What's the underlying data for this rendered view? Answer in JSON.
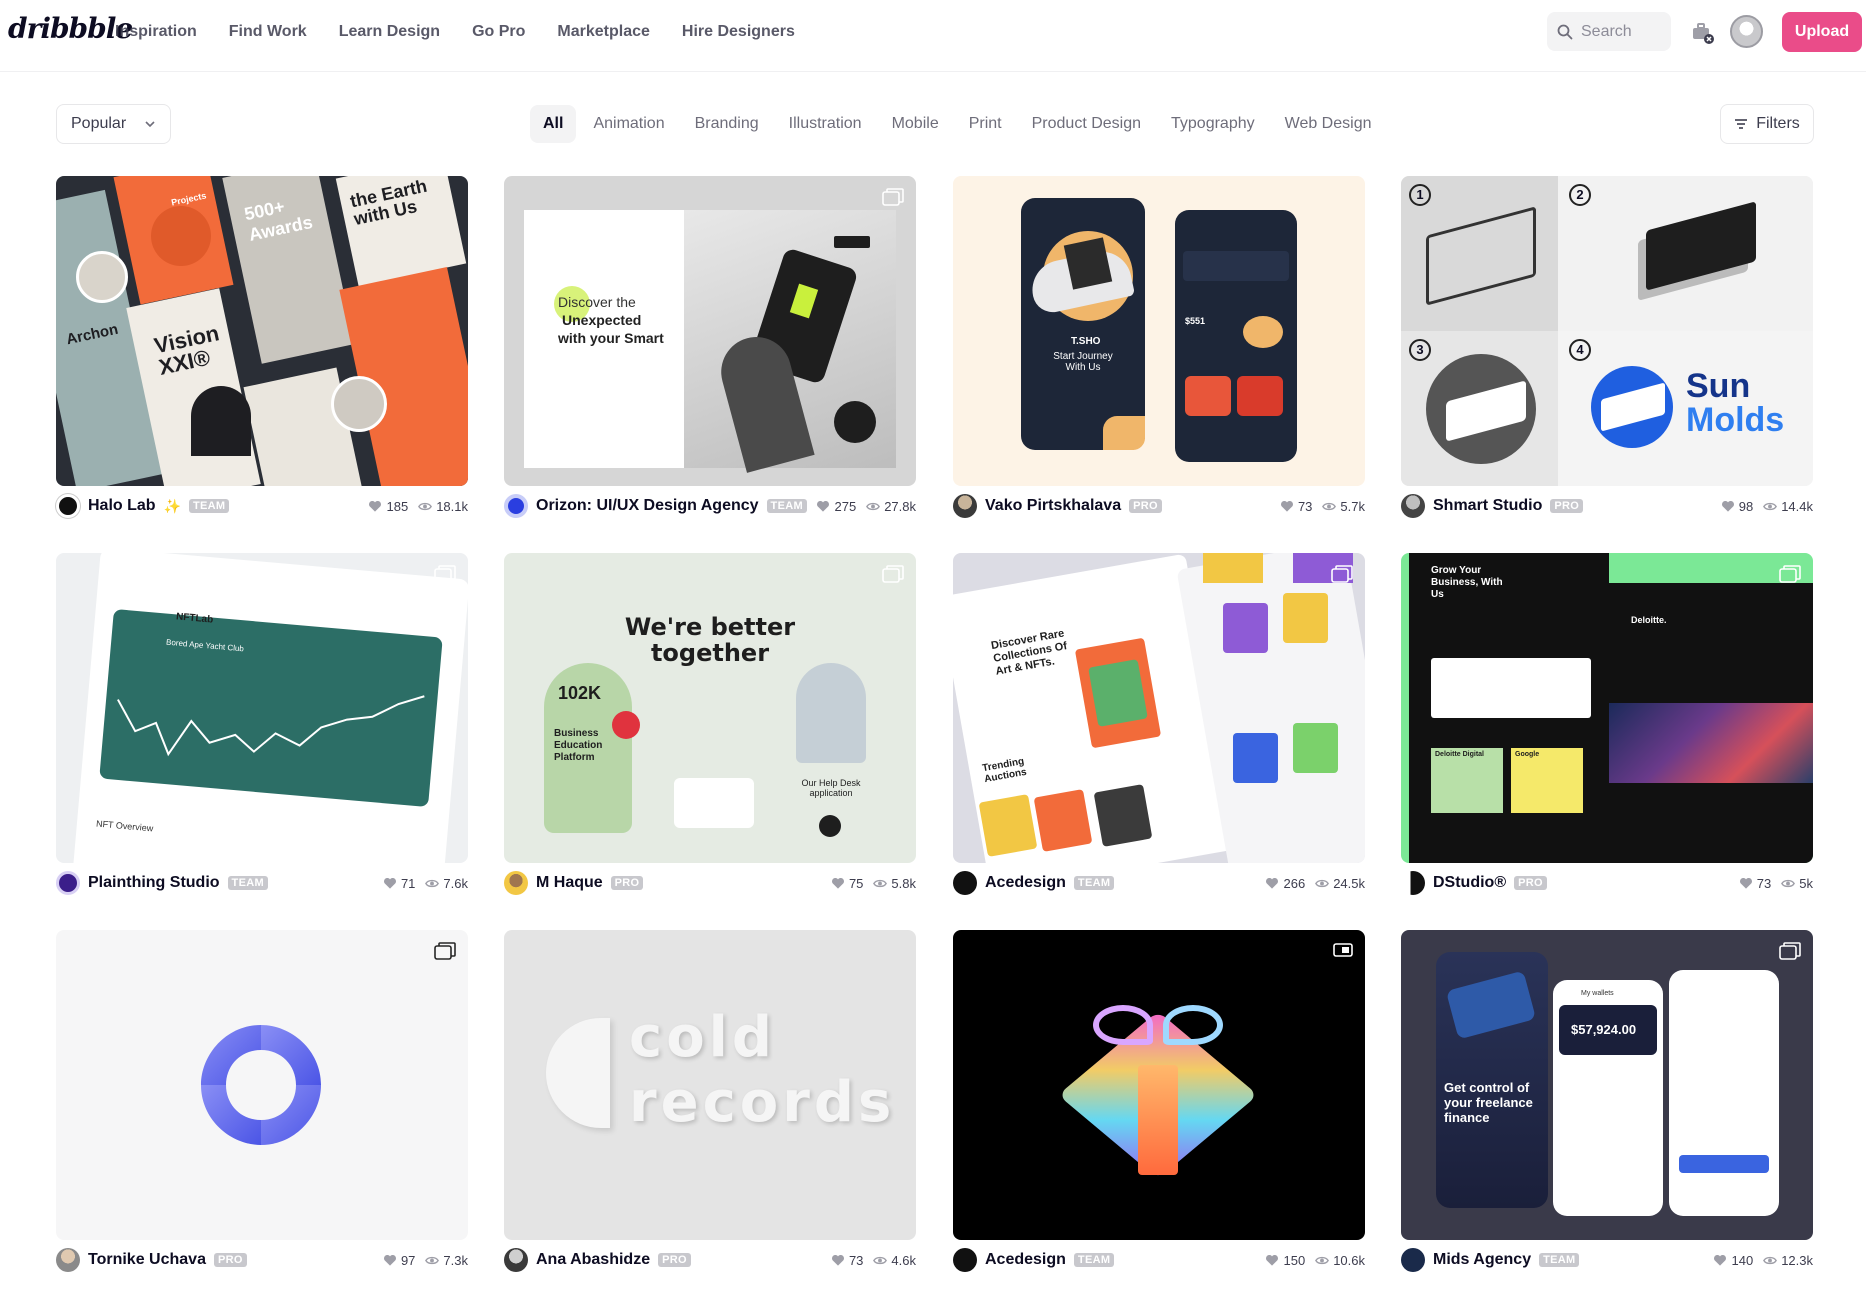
{
  "brand": {
    "logo_text": "dribbble"
  },
  "nav": {
    "items": [
      "Inspiration",
      "Find Work",
      "Learn Design",
      "Go Pro",
      "Marketplace",
      "Hire Designers"
    ]
  },
  "search": {
    "placeholder": "Search"
  },
  "upload": {
    "label": "Upload"
  },
  "sort": {
    "selected": "Popular"
  },
  "categories": {
    "items": [
      "All",
      "Animation",
      "Branding",
      "Illustration",
      "Mobile",
      "Print",
      "Product Design",
      "Typography",
      "Web Design"
    ],
    "active": "All"
  },
  "filters": {
    "label": "Filters"
  },
  "colors": {
    "accent": "#ea4c89",
    "text": "#0d0c22",
    "muted": "#6e6d7a",
    "badge": "#c8c8cd"
  },
  "shots": [
    {
      "author": "Halo Lab",
      "badge": "TEAM",
      "sparkle": true,
      "likes": "185",
      "views": "18.1k",
      "icon": "halo-lab-avatar",
      "art": {
        "words": [
          "Archon",
          "Vision XXI®",
          "500+ Awards",
          "Projects",
          "the Earth with Us"
        ]
      }
    },
    {
      "author": "Orizon: UI/UX Design Agency",
      "badge": "TEAM",
      "likes": "275",
      "views": "27.8k",
      "icon": "orizon-avatar",
      "art": {
        "words": [
          "Discover the",
          "Unexpected",
          "with your Smart"
        ]
      }
    },
    {
      "author": "Vako Pirtskhalava",
      "badge": "PRO",
      "likes": "73",
      "views": "5.7k",
      "icon": "vako-avatar",
      "art": {
        "words": [
          "T.SHO",
          "Start Journey With Us",
          "$551"
        ]
      }
    },
    {
      "author": "Shmart Studio",
      "badge": "PRO",
      "likes": "98",
      "views": "14.4k",
      "icon": "shmart-avatar",
      "art": {
        "words": [
          "Sun",
          "Molds",
          "1",
          "2",
          "3",
          "4"
        ]
      }
    },
    {
      "author": "Plainthing Studio",
      "badge": "TEAM",
      "likes": "71",
      "views": "7.6k",
      "icon": "plainthing-avatar",
      "art": {
        "words": [
          "NFTLab",
          "Bored Ape Yacht Club",
          "NFT Overview"
        ]
      }
    },
    {
      "author": "M Haque",
      "badge": "PRO",
      "likes": "75",
      "views": "5.8k",
      "icon": "m-haque-avatar",
      "art": {
        "words": [
          "We're better",
          "together",
          "102K",
          "Business Education Platform",
          "Our Help Desk application"
        ]
      }
    },
    {
      "author": "Acedesign",
      "badge": "TEAM",
      "likes": "266",
      "views": "24.5k",
      "icon": "acedesign-avatar",
      "art": {
        "words": [
          "Discover Rare Collections Of Art & NFTs.",
          "Trending Auctions"
        ]
      }
    },
    {
      "author": "DStudio®",
      "badge": "PRO",
      "likes": "73",
      "views": "5k",
      "icon": "dstudio-avatar",
      "art": {
        "words": [
          "Grow Your Business, With Us",
          "Deloitte.",
          "Deloitte Digital",
          "Google"
        ]
      }
    },
    {
      "author": "Tornike Uchava",
      "badge": "PRO",
      "likes": "97",
      "views": "7.3k",
      "icon": "tornike-avatar",
      "art": {
        "words": []
      }
    },
    {
      "author": "Ana Abashidze",
      "badge": "PRO",
      "likes": "73",
      "views": "4.6k",
      "icon": "ana-avatar",
      "art": {
        "words": [
          "cold",
          "records"
        ]
      }
    },
    {
      "author": "Acedesign",
      "badge": "TEAM",
      "likes": "150",
      "views": "10.6k",
      "icon": "acedesign-avatar",
      "art": {
        "words": []
      }
    },
    {
      "author": "Mids Agency",
      "badge": "TEAM",
      "likes": "140",
      "views": "12.3k",
      "icon": "mids-avatar",
      "art": {
        "words": [
          "Get control of your freelance finance",
          "$57,924.00",
          "My wallets"
        ]
      }
    }
  ]
}
